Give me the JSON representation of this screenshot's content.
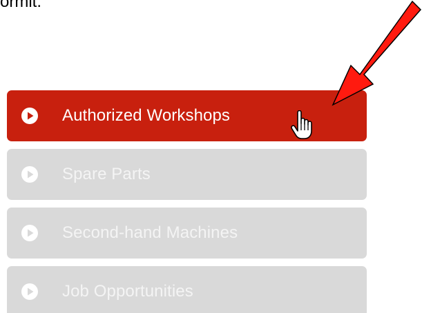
{
  "top_text": "ormit.",
  "menu": {
    "items": [
      {
        "label": "Authorized Workshops",
        "active": true
      },
      {
        "label": "Spare Parts",
        "active": false
      },
      {
        "label": "Second-hand Machines",
        "active": false
      },
      {
        "label": "Job Opportunities",
        "active": false
      }
    ]
  },
  "colors": {
    "active_bg": "#c8200e",
    "inactive_bg": "#d9d9d9",
    "annotation_arrow": "#ff0000"
  },
  "icons": {
    "menu_item": "play-circle-icon",
    "cursor": "hand-pointer-cursor-icon",
    "annotation": "red-arrow-icon"
  }
}
